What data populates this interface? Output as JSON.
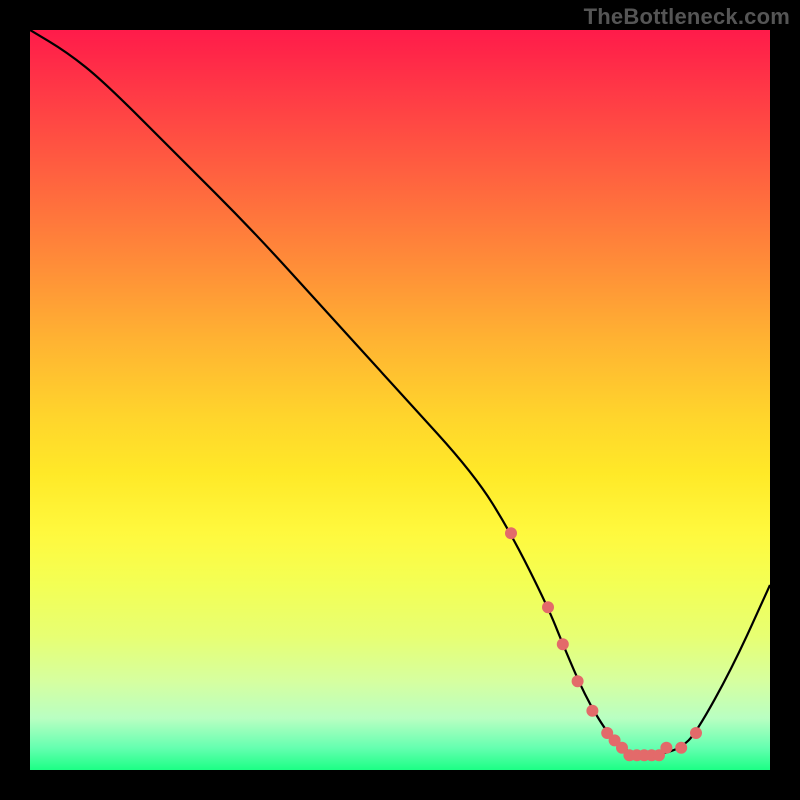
{
  "watermark": "TheBottleneck.com",
  "chart_data": {
    "type": "line",
    "title": "",
    "xlabel": "",
    "ylabel": "",
    "xlim": [
      0,
      100
    ],
    "ylim": [
      0,
      100
    ],
    "gradient_colors": {
      "top": "#ff1b4a",
      "mid_upper": "#ff8e38",
      "mid": "#ffe928",
      "mid_lower": "#d6ffa0",
      "bottom": "#1cff85"
    },
    "series": [
      {
        "name": "curve",
        "color": "#000000",
        "x": [
          0,
          5,
          10,
          20,
          30,
          40,
          50,
          60,
          65,
          70,
          72,
          75,
          78,
          80,
          82,
          85,
          88,
          90,
          95,
          100
        ],
        "values": [
          100,
          97,
          93,
          83,
          73,
          62,
          51,
          40,
          32,
          22,
          17,
          10,
          5,
          3,
          2,
          2,
          3,
          5,
          14,
          25
        ]
      },
      {
        "name": "dots",
        "color": "#e36a6a",
        "x": [
          65,
          70,
          72,
          74,
          76,
          78,
          79,
          80,
          81,
          82,
          83,
          84,
          85,
          86,
          88,
          90
        ],
        "values": [
          32,
          22,
          17,
          12,
          8,
          5,
          4,
          3,
          2,
          2,
          2,
          2,
          2,
          3,
          3,
          5
        ]
      }
    ]
  }
}
